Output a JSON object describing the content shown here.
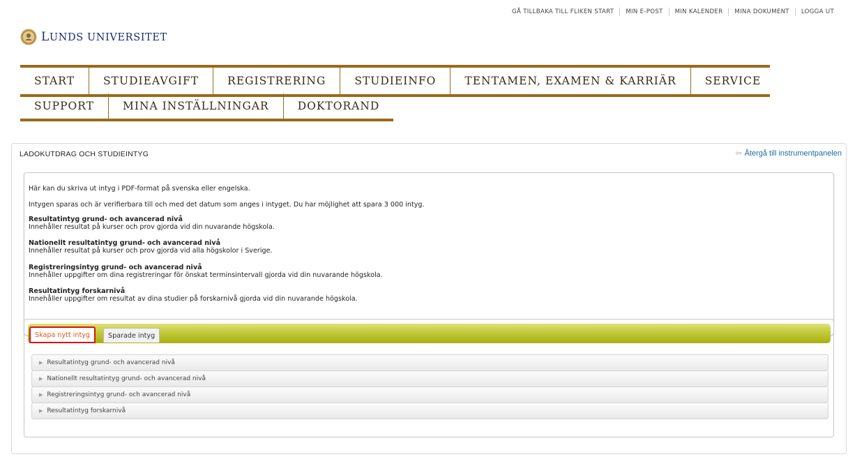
{
  "top_links": [
    "GÅ TILLBAKA TILL FLIKEN START",
    "MIN E-POST",
    "MIN KALENDER",
    "MINA DOKUMENT",
    "LOGGA UT"
  ],
  "logo": {
    "first_letter": "L",
    "rest_first_word": "UNDS",
    "second_word": "UNIVERSITET"
  },
  "nav": {
    "row1": [
      "START",
      "STUDIEAVGIFT",
      "REGISTRERING",
      "STUDIEINFO",
      "TENTAMEN, EXAMEN & KARRIÄR",
      "SERVICE"
    ],
    "row2": [
      "SUPPORT",
      "MINA INSTÄLLNINGAR",
      "DOKTORAND"
    ]
  },
  "panel": {
    "title": "LADOKUTDRAG OCH STUDIEINTYG",
    "back_link": "Återgå till instrumentpanelen",
    "intro1": "Här kan du skriva ut intyg i PDF-format på svenska eller engelska.",
    "intro2": "Intygen sparas och är verifierbara till och med det datum som anges i intyget. Du har möjlighet att spara 3 000 intyg.",
    "types": [
      {
        "title": "Resultatintyg grund- och avancerad nivå",
        "desc": "Innehåller resultat på kurser och prov gjorda vid din nuvarande högskola."
      },
      {
        "title": "Nationellt resultatintyg grund- och avancerad nivå",
        "desc": "Innehåller resultat på kurser och prov gjorda vid alla högskolor i Sverige."
      },
      {
        "title": "Registreringsintyg grund- och avancerad nivå",
        "desc": "Innehåller uppgifter om dina registreringar för önskat terminsintervall gjorda vid din nuvarande högskola."
      },
      {
        "title": "Resultatintyg forskarnivå",
        "desc": "Innehåller uppgifter om resultat av dina studier på forskarnivå gjorda vid din nuvarande högskola."
      }
    ]
  },
  "tabs": {
    "active": "Skapa nytt intyg",
    "saved": "Sparade intyg"
  },
  "accordion": [
    "Resultatintyg grund- och avancerad nivå",
    "Nationellt resultatintyg grund- och avancerad nivå",
    "Registreringsintyg grund- och avancerad nivå",
    "Resultatintyg forskarnivå"
  ],
  "colors": {
    "nav_border": "#9a6a1a",
    "tabbar": "#b6bd25",
    "link": "#1f6aa6",
    "active_tab_text": "#e05a1a",
    "highlight": "#e01010"
  }
}
